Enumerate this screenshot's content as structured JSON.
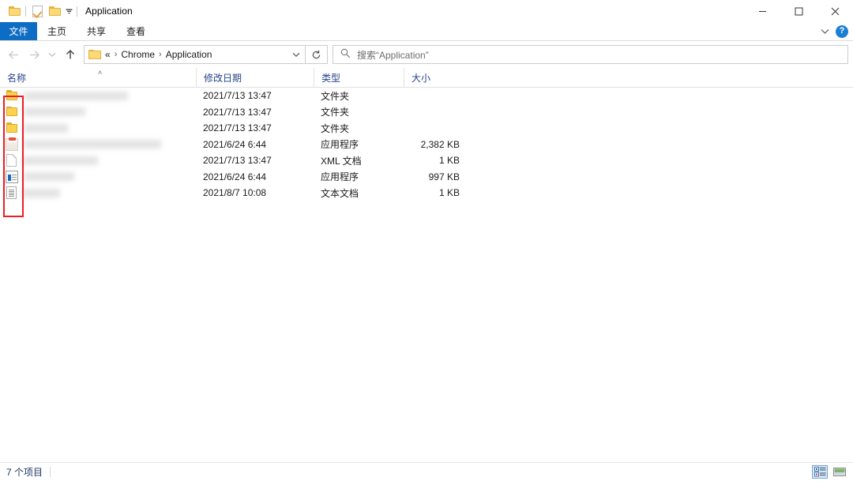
{
  "window": {
    "title": "Application",
    "quick_access": [
      {
        "name": "folder-icon",
        "label": "文件夹"
      },
      {
        "name": "properties-icon",
        "label": "属性"
      },
      {
        "name": "new-folder-icon",
        "label": "新建文件夹"
      }
    ],
    "controls": {
      "minimize": "—",
      "maximize": "□",
      "close": "✕"
    }
  },
  "ribbon": {
    "tabs": [
      {
        "label": "文件",
        "selected": true
      },
      {
        "label": "主页",
        "selected": false
      },
      {
        "label": "共享",
        "selected": false
      },
      {
        "label": "查看",
        "selected": false
      }
    ],
    "accent_color": "#0d6cc4",
    "expand_label": "∨",
    "help_label": "?"
  },
  "address": {
    "back_label": "←",
    "forward_label": "→",
    "recent_label": "∨",
    "up_label": "↑",
    "crumb_prefix": "«",
    "crumbs": [
      "Chrome",
      "Application"
    ],
    "crumb_separator": "›",
    "dropdown_label": "∨",
    "refresh_label": "↻"
  },
  "search": {
    "placeholder": "搜索“Application”"
  },
  "columns": {
    "name": "名称",
    "date": "修改日期",
    "type": "类型",
    "size": "大小",
    "sort_caret": "˄"
  },
  "files": [
    {
      "icon": "folder-icon",
      "name": "",
      "date": "2021/7/13 13:47",
      "type": "文件夹",
      "size": "",
      "name_width": 132,
      "redacted": true
    },
    {
      "icon": "folder-icon",
      "name": "",
      "date": "2021/7/13 13:47",
      "type": "文件夹",
      "size": "",
      "name_width": 78,
      "redacted": true
    },
    {
      "icon": "folder-icon",
      "name": "",
      "date": "2021/7/13 13:47",
      "type": "文件夹",
      "size": "",
      "name_width": 56,
      "redacted": true
    },
    {
      "icon": "application-icon",
      "name": "",
      "date": "2021/6/24 6:44",
      "type": "应用程序",
      "size": "2,382 KB",
      "name_width": 174,
      "redacted": true
    },
    {
      "icon": "xml-document-icon",
      "name": "",
      "date": "2021/7/13 13:47",
      "type": "XML 文档",
      "size": "1 KB",
      "name_width": 96,
      "redacted": true
    },
    {
      "icon": "executable-icon",
      "name": "",
      "date": "2021/6/24 6:44",
      "type": "应用程序",
      "size": "997 KB",
      "name_width": 64,
      "redacted": true
    },
    {
      "icon": "text-document-icon",
      "name": "",
      "date": "2021/8/7 10:08",
      "type": "文本文档",
      "size": "1 KB",
      "name_width": 48,
      "redacted": true
    }
  ],
  "annotation": {
    "color": "#ee1c23",
    "shape": "rectangle",
    "target": "file-icon-column"
  },
  "status": {
    "item_count": "7 个项目",
    "views": [
      {
        "name": "details-view-button",
        "active": true
      },
      {
        "name": "large-icons-view-button",
        "active": false
      }
    ]
  }
}
